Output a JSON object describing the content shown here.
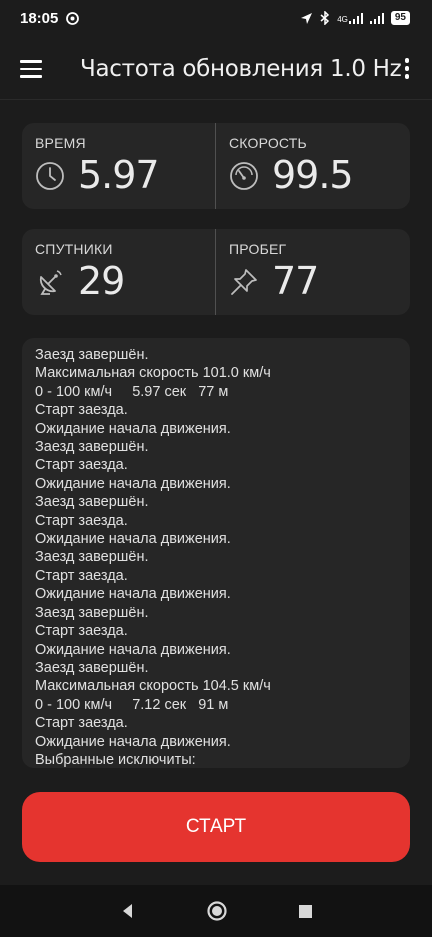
{
  "status_bar": {
    "time": "18:05",
    "network": "4G",
    "battery": "95"
  },
  "app_bar": {
    "title": "Частота обновления 1.0 Hz",
    "menu_icon": "hamburger-menu-icon",
    "more_icon": "more-vert-icon"
  },
  "stats": {
    "time": {
      "label": "ВРЕМЯ",
      "value": "5.97",
      "icon": "clock-icon"
    },
    "speed": {
      "label": "СКОРОСТЬ",
      "value": "99.5",
      "icon": "speedometer-icon"
    },
    "satellites": {
      "label": "СПУТНИКИ",
      "value": "29",
      "icon": "satellite-icon"
    },
    "distance": {
      "label": "ПРОБЕГ",
      "value": "77",
      "icon": "pin-icon"
    }
  },
  "log": {
    "lines": [
      "Заезд завершён.",
      "Максимальная скорость 101.0 км/ч",
      "0 - 100 км/ч     5.97 сек   77 м",
      "Старт заезда.",
      "Ожидание начала движения.",
      "Заезд завершён.",
      "Старт заезда.",
      "Ожидание начала движения.",
      "Заезд завершён.",
      "Старт заезда.",
      "Ожидание начала движения.",
      "Заезд завершён.",
      "Старт заезда.",
      "Ожидание начала движения.",
      "Заезд завершён.",
      "Старт заезда.",
      "Ожидание начала движения.",
      "Заезд завершён.",
      "Максимальная скорость 104.5 км/ч",
      "0 - 100 км/ч     7.12 сек   91 м",
      "Старт заезда.",
      "Ожидание начала движения.",
      "Выбранные исключиты:"
    ]
  },
  "start_button": {
    "label": "СТАРТ"
  },
  "colors": {
    "accent": "#e5342f",
    "background": "#1c1c1c",
    "card": "#262626"
  }
}
